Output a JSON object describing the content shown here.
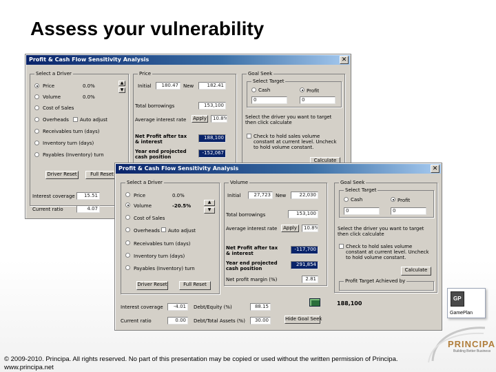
{
  "slide": {
    "title": "Assess your vulnerability",
    "footer": "© 2009-2010. Principa. All rights reserved. No part of this presentation may be copied or used without the written permission of Principa. www.principa.net",
    "logo_text": "PRINCIPA",
    "logo_sub": "Building Better Business",
    "gameplan_label": "GamePlan",
    "gameplan_badge": "GP"
  },
  "back_window": {
    "title": "Profit & Cash Flow Sensitivity Analysis",
    "driver_group": "Select a Driver",
    "drivers": [
      {
        "label": "Price",
        "value": "0.0%",
        "selected": true
      },
      {
        "label": "Volume",
        "value": "0.0%",
        "selected": false
      },
      {
        "label": "Cost of Sales",
        "selected": false
      },
      {
        "label": "Overheads",
        "selected": false
      },
      {
        "label": "Receivables turn (days)",
        "selected": false
      },
      {
        "label": "Inventory turn (days)",
        "selected": false
      },
      {
        "label": "Payables (Inventory) turn",
        "selected": false
      }
    ],
    "auto_adjust": "Auto adjust",
    "driver_reset": "Driver Reset",
    "full_reset": "Full Reset",
    "interest_cover_label": "Interest coverage",
    "interest_cover_value": "15.51",
    "current_ratio_label": "Current ratio",
    "current_ratio_value": "4.07",
    "price_group": "Price",
    "initial_label": "Initial",
    "initial_value": "180.47",
    "new_label": "New",
    "new_value": "182.41",
    "total_borrowings_label": "Total borrowings",
    "total_borrowings_value": "153,100",
    "avg_interest_label": "Average interest rate",
    "apply": "Apply",
    "avg_interest_value": "10.8%",
    "net_profit_label": "Net Profit after tax & interest",
    "net_profit_value": "188,100",
    "year_end_label": "Year end projected cash position",
    "year_end_value": "-152,067",
    "goal_group": "Goal Seek",
    "target_group": "Select Target",
    "target_cash": "Cash",
    "target_profit": "Profit",
    "target_cash_value": "0",
    "target_profit_value": "0",
    "goal_text": "Select the driver you want to target then click calculate",
    "goal_check_text": "Check to hold sales volume constant at current level. Uncheck to hold volume constant.",
    "calculate": "Calculate"
  },
  "front_window": {
    "title": "Profit & Cash Flow Sensitivity Analysis",
    "driver_group": "Select a Driver",
    "drivers": [
      {
        "label": "Price",
        "value": "0.0%",
        "selected": false
      },
      {
        "label": "Volume",
        "value": "-20.5%",
        "selected": true
      },
      {
        "label": "Cost of Sales",
        "selected": false
      },
      {
        "label": "Overheads",
        "selected": false
      },
      {
        "label": "Receivables turn (days)",
        "selected": false
      },
      {
        "label": "Inventory turn (days)",
        "selected": false
      },
      {
        "label": "Payables (Inventory) turn",
        "selected": false
      }
    ],
    "auto_adjust": "Auto adjust",
    "driver_reset": "Driver Reset",
    "full_reset": "Full Reset",
    "interest_cover_label": "Interest coverage",
    "interest_cover_value": "-4.01",
    "current_ratio_label": "Current ratio",
    "current_ratio_value": "0.00",
    "debt_equity_label": "Debt/Equity (%)",
    "debt_equity_value": "88.15",
    "debt_assets_label": "Debt/Total Assets (%)",
    "debt_assets_value": "30.00",
    "volume_group": "Volume",
    "initial_label": "Initial",
    "initial_value": "27,723",
    "new_label": "New",
    "new_value": "22,030",
    "total_borrowings_label": "Total borrowings",
    "total_borrowings_value": "153,100",
    "avg_interest_label": "Average interest rate",
    "apply": "Apply",
    "avg_interest_value": "10.8%",
    "net_profit_label": "Net Profit after tax & interest",
    "net_profit_value": "-117,700",
    "year_end_label": "Year end projected cash position",
    "year_end_value": "291,854",
    "margin_label": "Net profit margin (%)",
    "margin_value": "2.81",
    "goal_group": "Goal Seek",
    "target_group": "Select Target",
    "target_cash": "Cash",
    "target_profit": "Profit",
    "target_cash_value": "0",
    "target_profit_value": "0",
    "goal_text": "Select the driver you want to target then click calculate",
    "goal_check_text": "Check to hold sales volume constant at current level. Uncheck to hold volume constant.",
    "calculate": "Calculate",
    "profit_target_label": "Profit Target Achieved by",
    "bottom_value": "188,100",
    "hide_goal_seek": "Hide Goal Seek"
  }
}
